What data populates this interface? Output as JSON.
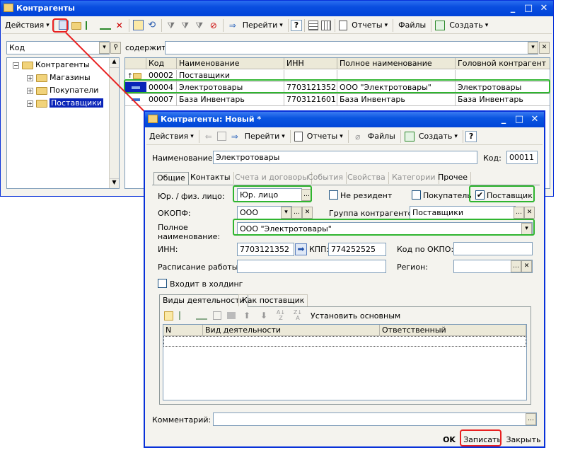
{
  "main_window": {
    "title": "Контрагенты",
    "toolbar": {
      "actions_label": "Действия",
      "goto_label": "Перейти",
      "help_label": "?",
      "reports_label": "Отчеты",
      "files_label": "Файлы",
      "create_label": "Создать"
    },
    "search": {
      "field_value": "Код",
      "contains_label": "содержит:",
      "contains_value": ""
    },
    "tree": {
      "root": "Контрагенты",
      "children": [
        "Магазины",
        "Покупатели",
        "Поставщики"
      ],
      "selected": "Поставщики"
    },
    "list": {
      "columns": [
        "Код",
        "Наименование",
        "ИНН",
        "Полное наименование",
        "Головной контрагент"
      ],
      "rows": [
        {
          "code": "00002",
          "name": "Поставщики",
          "inn": "",
          "full_name": "",
          "parent": "",
          "type": "folder"
        },
        {
          "code": "00004",
          "name": "Электротовары",
          "inn": "7703121352",
          "full_name": "ООО \"Электротовары\"",
          "parent": "Электротовары",
          "type": "item"
        },
        {
          "code": "00007",
          "name": "База Инвентарь",
          "inn": "7703121601",
          "full_name": "База Инвентарь",
          "parent": "База Инвентарь",
          "type": "item"
        }
      ]
    }
  },
  "dialog": {
    "title": "Контрагенты: Новый *",
    "toolbar": {
      "actions_label": "Действия",
      "goto_label": "Перейти",
      "reports_label": "Отчеты",
      "files_label": "Файлы",
      "create_label": "Создать",
      "help_label": "?"
    },
    "name_label": "Наименование:",
    "name_value": "Электротовары",
    "code_label": "Код:",
    "code_value": "00011",
    "tabs": [
      "Общие",
      "Контакты",
      "Счета и договоры",
      "События",
      "Свойства",
      "Категории",
      "Прочее"
    ],
    "active_tab": "Общие",
    "legal_type_label": "Юр. / физ. лицо:",
    "legal_type_value": "Юр. лицо",
    "nonresident_label": "Не резидент",
    "nonresident_checked": false,
    "buyer_label": "Покупатель",
    "buyer_checked": false,
    "supplier_label": "Поставщик",
    "supplier_checked": true,
    "okopf_label": "ОКОПФ:",
    "okopf_value": "ООО",
    "group_label": "Группа контрагентов:",
    "group_value": "Поставщики",
    "full_name_label_1": "Полное",
    "full_name_label_2": "наименование:",
    "full_name_value": "ООО \"Электротовары\"",
    "inn_label": "ИНН:",
    "inn_value": "7703121352",
    "kpp_label": "КПП:",
    "kpp_value": "774252525",
    "okpo_label": "Код по ОКПО:",
    "okpo_value": "",
    "schedule_label": "Расписание работы:",
    "schedule_value": "",
    "region_label": "Регион:",
    "region_value": "",
    "holding_label": "Входит в холдинг",
    "holding_checked": false,
    "subtabs": [
      "Виды деятельности",
      "Как поставщик"
    ],
    "set_main_label": "Установить основным",
    "activity_columns": [
      "N",
      "Вид деятельности",
      "Ответственный"
    ],
    "comment_label": "Комментарий:",
    "comment_value": "",
    "ok_label": "OK",
    "save_label": "Записать",
    "close_label": "Закрыть"
  },
  "colors": {
    "title_bar": "#0a4ee0",
    "highlight_green": "#2fb52f",
    "highlight_red": "#e82020",
    "selection": "#0a24b8"
  }
}
